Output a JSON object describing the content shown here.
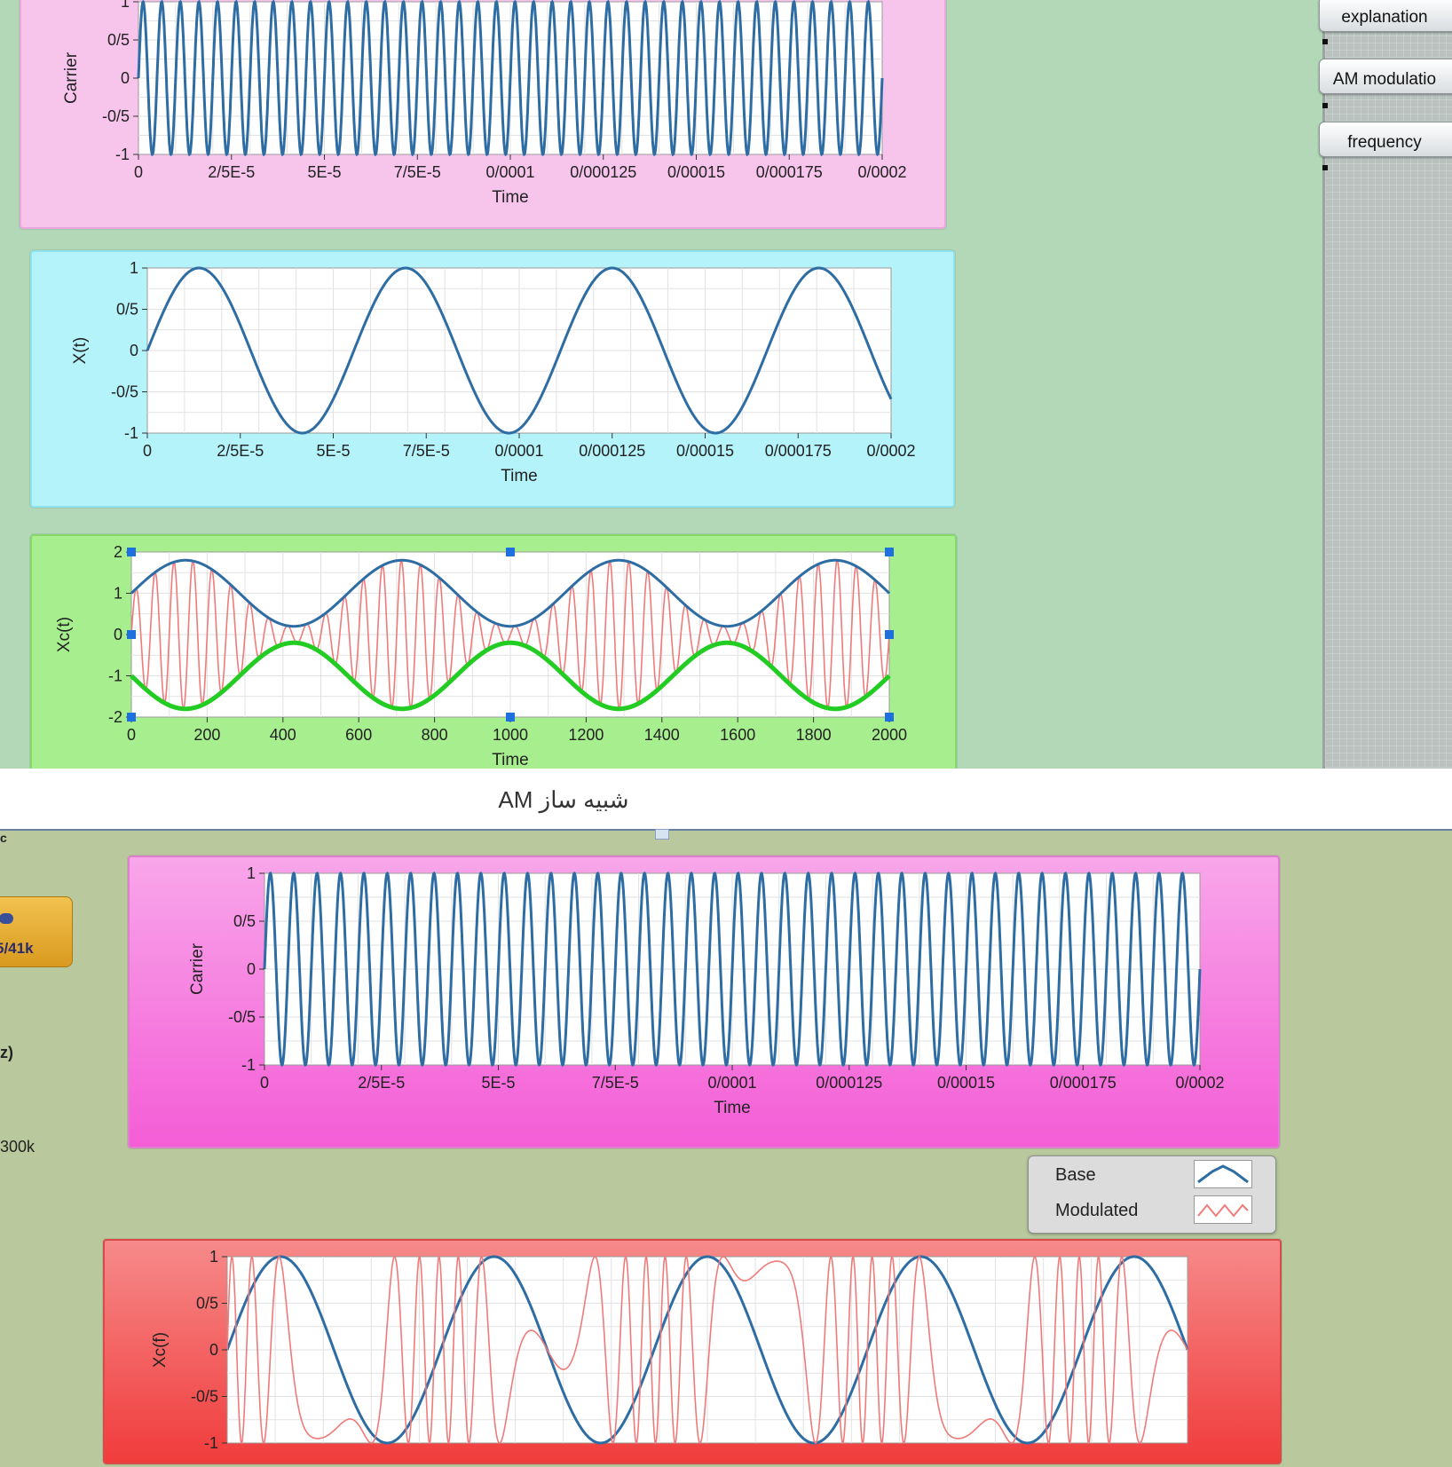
{
  "window": {
    "title": "شبیه ساز AM"
  },
  "sidebar": {
    "buttons": [
      {
        "label": "explanation"
      },
      {
        "label": "AM modulatio"
      },
      {
        "label": "frequency"
      }
    ]
  },
  "left_controls": {
    "knob_text": "5/41k",
    "label_hz": "z)",
    "label_300k": "300k",
    "label_top": "c"
  },
  "legend": {
    "entries": [
      {
        "label": "Base",
        "color": "#2e6da4"
      },
      {
        "label": "Modulated",
        "color": "#f07a7a"
      }
    ]
  },
  "colors": {
    "base": "#2e6da4",
    "modulated": "#f07a7a",
    "envelope_lower": "#22cc22",
    "panel_pink_top": "#f8c8ee",
    "panel_cyan": "#b5f3fb",
    "panel_green": "#a6ee8e",
    "panel_magenta": "#f46fdc",
    "panel_red": "#f25757"
  },
  "chart_data": [
    {
      "type": "line",
      "panel": "top-carrier",
      "xlabel": "Time",
      "ylabel": "Carrier",
      "ylim": [
        -1,
        1
      ],
      "yticks": [
        "1",
        "0/5",
        "0",
        "-0/5",
        "-1"
      ],
      "xticks": [
        "0",
        "2/5E-5",
        "5E-5",
        "7/5E-5",
        "0/0001",
        "0/000125",
        "0/00015",
        "0/000175",
        "0/0002"
      ],
      "series": [
        {
          "signal": "sin",
          "cycles": 40
        }
      ]
    },
    {
      "type": "line",
      "panel": "message",
      "xlabel": "Time",
      "ylabel": "X(t)",
      "ylim": [
        -1,
        1
      ],
      "yticks": [
        "1",
        "0/5",
        "0",
        "-0/5",
        "-1"
      ],
      "xticks": [
        "0",
        "2/5E-5",
        "5E-5",
        "7/5E-5",
        "0/0001",
        "0/000125",
        "0/00015",
        "0/000175",
        "0/0002"
      ],
      "series": [
        {
          "signal": "sin",
          "cycles": 3.6
        }
      ]
    },
    {
      "type": "line",
      "panel": "modulated",
      "xlabel": "Time",
      "ylabel": "Xc(t)",
      "ylim": [
        -2,
        2
      ],
      "yticks": [
        "2",
        "1",
        "0",
        "-1",
        "-2"
      ],
      "xticks": [
        "0",
        "200",
        "400",
        "600",
        "800",
        "1000",
        "1200",
        "1400",
        "1600",
        "1800",
        "2000"
      ],
      "series": [
        {
          "signal": "am",
          "cycles": 3.5,
          "carrier_cycles": 40,
          "offset": 1,
          "depth": 0.8
        },
        {
          "signal": "envelope_upper",
          "cycles": 3.5,
          "offset": 1,
          "depth": 0.8
        },
        {
          "signal": "envelope_lower",
          "cycles": 3.5,
          "offset": 1,
          "depth": 0.8
        }
      ]
    },
    {
      "type": "line",
      "panel": "bottom-carrier",
      "xlabel": "Time",
      "ylabel": "Carrier",
      "ylim": [
        -1,
        1
      ],
      "yticks": [
        "1",
        "0/5",
        "0",
        "-0/5",
        "-1"
      ],
      "xticks": [
        "0",
        "2/5E-5",
        "5E-5",
        "7/5E-5",
        "0/0001",
        "0/000125",
        "0/00015",
        "0/000175",
        "0/0002"
      ],
      "series": [
        {
          "signal": "sin",
          "cycles": 40
        }
      ]
    },
    {
      "type": "line",
      "panel": "fm",
      "xlabel": "",
      "ylabel": "Xc(f)",
      "ylim": [
        -1,
        1
      ],
      "yticks": [
        "1",
        "0/5",
        "0",
        "-0/5",
        "-1"
      ],
      "xticks": [],
      "series": [
        {
          "name": "Base",
          "signal": "sin",
          "cycles": 4.5
        },
        {
          "name": "Modulated",
          "signal": "fm",
          "cycles": 4.5,
          "carrier_cycles": 24,
          "index": 6
        }
      ]
    }
  ]
}
